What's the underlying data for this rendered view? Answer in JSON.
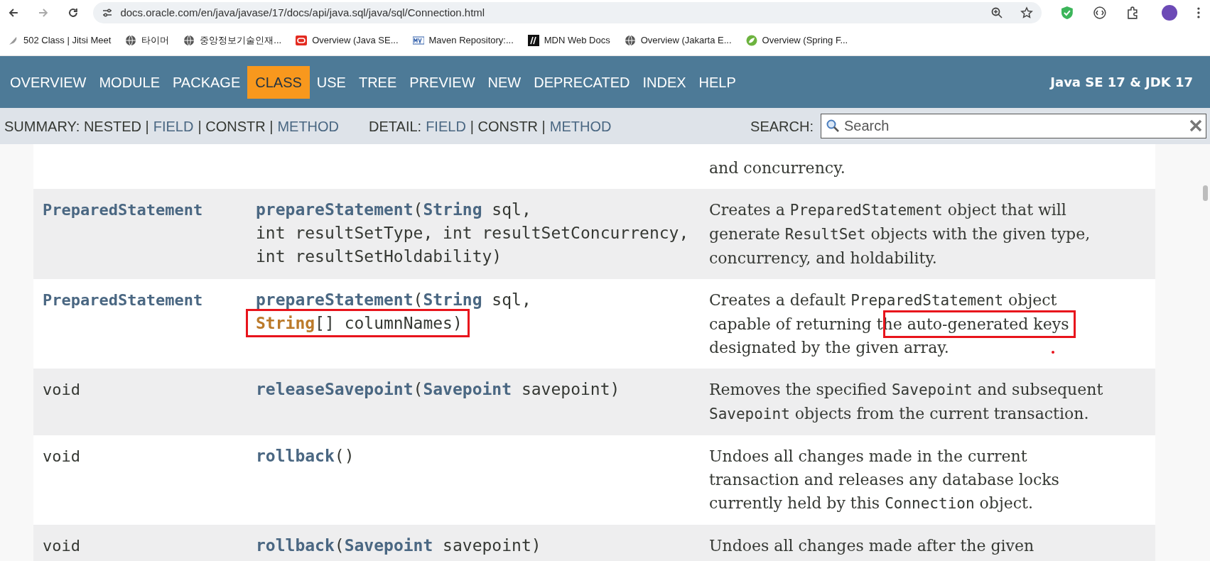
{
  "browser": {
    "url": "docs.oracle.com/en/java/javase/17/docs/api/java.sql/java/sql/Connection.html",
    "bookmarks": [
      {
        "label": "502 Class | Jitsi Meet",
        "kind": "feather"
      },
      {
        "label": "타이머",
        "kind": "globe"
      },
      {
        "label": "중앙정보기술인재...",
        "kind": "globe"
      },
      {
        "label": "Overview (Java SE...",
        "kind": "oracle"
      },
      {
        "label": "Maven Repository:...",
        "kind": "maven"
      },
      {
        "label": "MDN Web Docs",
        "kind": "mdn"
      },
      {
        "label": "Overview (Jakarta E...",
        "kind": "globe"
      },
      {
        "label": "Overview (Spring F...",
        "kind": "spring"
      }
    ]
  },
  "nav": {
    "items": [
      {
        "label": "OVERVIEW",
        "selected": false
      },
      {
        "label": "MODULE",
        "selected": false
      },
      {
        "label": "PACKAGE",
        "selected": false
      },
      {
        "label": "CLASS",
        "selected": true
      },
      {
        "label": "USE",
        "selected": false
      },
      {
        "label": "TREE",
        "selected": false
      },
      {
        "label": "PREVIEW",
        "selected": false
      },
      {
        "label": "NEW",
        "selected": false
      },
      {
        "label": "DEPRECATED",
        "selected": false
      },
      {
        "label": "INDEX",
        "selected": false
      },
      {
        "label": "HELP",
        "selected": false
      }
    ],
    "title": "Java SE 17 & JDK 17"
  },
  "subnav": {
    "summary": [
      {
        "t": "SUMMARY: NESTED |",
        "kind": "text"
      },
      {
        "t": "FIELD",
        "kind": "link"
      },
      {
        "t": "| CONSTR |",
        "kind": "text"
      },
      {
        "t": "METHOD",
        "kind": "link"
      }
    ],
    "detail": [
      {
        "t": "DETAIL:",
        "kind": "text"
      },
      {
        "t": "FIELD",
        "kind": "link"
      },
      {
        "t": "| CONSTR |",
        "kind": "text"
      },
      {
        "t": "METHOD",
        "kind": "link"
      }
    ],
    "search_label": "SEARCH:",
    "search_placeholder": "Search"
  },
  "rows": [
    {
      "shaded": false,
      "description": [
        [
          {
            "t": "and concurrency.",
            "kind": "plain"
          }
        ]
      ]
    },
    {
      "shaded": true,
      "type": {
        "t": "PreparedStatement",
        "kind": "link"
      },
      "signature": [
        [
          {
            "t": "prepareStatement",
            "kind": "link"
          },
          {
            "t": "(",
            "kind": "plain"
          },
          {
            "t": "String",
            "kind": "link"
          },
          {
            "t": " sql,",
            "kind": "plain"
          }
        ],
        [
          {
            "t": "int resultSetType, int resultSetConcurrency,",
            "kind": "plain"
          }
        ],
        [
          {
            "t": "int resultSetHoldability)",
            "kind": "plain"
          }
        ]
      ],
      "description": [
        [
          {
            "t": "Creates a ",
            "kind": "plain"
          },
          {
            "t": "PreparedStatement",
            "kind": "code"
          },
          {
            "t": " object that will",
            "kind": "plain"
          }
        ],
        [
          {
            "t": "generate ",
            "kind": "plain"
          },
          {
            "t": "ResultSet",
            "kind": "code"
          },
          {
            "t": " objects with the given type,",
            "kind": "plain"
          }
        ],
        [
          {
            "t": "concurrency, and holdability.",
            "kind": "plain"
          }
        ]
      ]
    },
    {
      "shaded": false,
      "marks": [
        {
          "kind": "dot"
        }
      ],
      "type": {
        "t": "PreparedStatement",
        "kind": "link"
      },
      "signature": [
        [
          {
            "t": "prepareStatement",
            "kind": "link"
          },
          {
            "t": "(",
            "kind": "plain"
          },
          {
            "t": "String",
            "kind": "link"
          },
          {
            "t": " sql,",
            "kind": "plain"
          }
        ],
        [
          {
            "kind": "boxed",
            "parts": [
              {
                "t": "String",
                "kind": "hover"
              },
              {
                "t": "[] columnNames)",
                "kind": "plain"
              }
            ]
          }
        ]
      ],
      "description": [
        [
          {
            "t": "Creates a default ",
            "kind": "plain"
          },
          {
            "t": "PreparedStatement",
            "kind": "code"
          },
          {
            "t": " object",
            "kind": "plain"
          }
        ],
        [
          {
            "t": "capable of returning th",
            "kind": "plain"
          },
          {
            "kind": "boxed",
            "parts": [
              {
                "t": "e auto-generated keys",
                "kind": "plain"
              }
            ]
          }
        ],
        [
          {
            "t": "designated by the given array.",
            "kind": "plain"
          }
        ]
      ]
    },
    {
      "shaded": true,
      "type": {
        "t": "void",
        "kind": "plain"
      },
      "signature": [
        [
          {
            "t": "releaseSavepoint",
            "kind": "link"
          },
          {
            "t": "(",
            "kind": "plain"
          },
          {
            "t": "Savepoint",
            "kind": "link"
          },
          {
            "t": " savepoint)",
            "kind": "plain"
          }
        ]
      ],
      "description": [
        [
          {
            "t": "Removes the specified ",
            "kind": "plain"
          },
          {
            "t": "Savepoint",
            "kind": "code"
          },
          {
            "t": " and subsequent",
            "kind": "plain"
          }
        ],
        [
          {
            "t": "Savepoint",
            "kind": "code"
          },
          {
            "t": " objects from the current transaction.",
            "kind": "plain"
          }
        ]
      ]
    },
    {
      "shaded": false,
      "type": {
        "t": "void",
        "kind": "plain"
      },
      "signature": [
        [
          {
            "t": "rollback",
            "kind": "link"
          },
          {
            "t": "()",
            "kind": "plain"
          }
        ]
      ],
      "description": [
        [
          {
            "t": "Undoes all changes made in the current",
            "kind": "plain"
          }
        ],
        [
          {
            "t": "transaction and releases any database locks",
            "kind": "plain"
          }
        ],
        [
          {
            "t": "currently held by this ",
            "kind": "plain"
          },
          {
            "t": "Connection",
            "kind": "code"
          },
          {
            "t": " object.",
            "kind": "plain"
          }
        ]
      ]
    },
    {
      "shaded": true,
      "type": {
        "t": "void",
        "kind": "plain"
      },
      "signature": [
        [
          {
            "t": "rollback",
            "kind": "link"
          },
          {
            "t": "(",
            "kind": "plain"
          },
          {
            "t": "Savepoint",
            "kind": "link"
          },
          {
            "t": " savepoint)",
            "kind": "plain"
          }
        ]
      ],
      "description": [
        [
          {
            "t": "Undoes all changes made after the given",
            "kind": "plain"
          }
        ]
      ]
    }
  ]
}
